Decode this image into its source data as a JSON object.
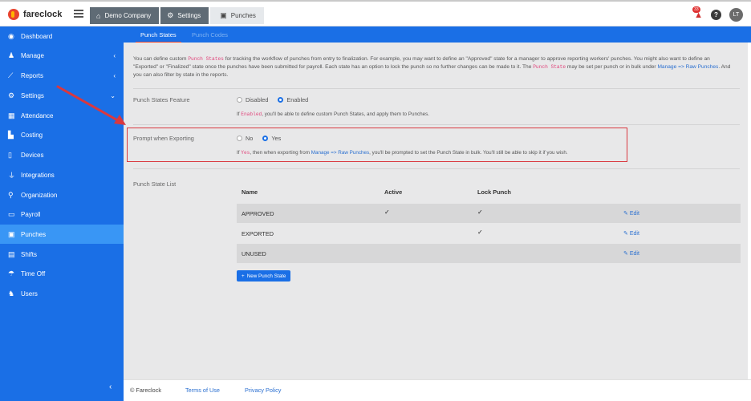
{
  "app": {
    "name": "fareclock"
  },
  "breadcrumb": [
    {
      "icon": "home-icon",
      "label": "Demo Company"
    },
    {
      "icon": "gear-icon",
      "label": "Settings"
    },
    {
      "icon": "punch-clock-icon",
      "label": "Punches"
    }
  ],
  "topbar": {
    "notification_count": "33",
    "help_label": "?",
    "avatar_initials": "LT"
  },
  "sidebar": {
    "items": [
      {
        "label": "Dashboard",
        "icon": "dashboard-icon",
        "chevron": ""
      },
      {
        "label": "Manage",
        "icon": "person-icon",
        "chevron": "‹"
      },
      {
        "label": "Reports",
        "icon": "chart-icon",
        "chevron": "‹"
      },
      {
        "label": "Settings",
        "icon": "gear-icon",
        "chevron": "⌄"
      },
      {
        "label": "Attendance",
        "icon": "grid-icon",
        "chevron": ""
      },
      {
        "label": "Costing",
        "icon": "bar-chart-icon",
        "chevron": ""
      },
      {
        "label": "Devices",
        "icon": "tablet-icon",
        "chevron": ""
      },
      {
        "label": "Integrations",
        "icon": "plug-icon",
        "chevron": ""
      },
      {
        "label": "Organization",
        "icon": "sitemap-icon",
        "chevron": ""
      },
      {
        "label": "Payroll",
        "icon": "money-icon",
        "chevron": ""
      },
      {
        "label": "Punches",
        "icon": "punch-clock-icon",
        "chevron": ""
      },
      {
        "label": "Shifts",
        "icon": "calendar-icon",
        "chevron": ""
      },
      {
        "label": "Time Off",
        "icon": "umbrella-icon",
        "chevron": ""
      },
      {
        "label": "Users",
        "icon": "users-icon",
        "chevron": ""
      }
    ],
    "active_index": 10,
    "collapse_label": "‹"
  },
  "tabs": [
    {
      "label": "Punch States",
      "active": true
    },
    {
      "label": "Punch Codes",
      "active": false
    }
  ],
  "intro": {
    "p1": "You can define custom ",
    "code1": "Punch States",
    "p2": " for tracking the workflow of punches from entry to finalization. For example, you may want to define an \"Approved\" state for a manager to approve reporting workers' punches. You might also want to define an \"Exported\" or \"Finalized\" state once the punches have been submitted for payroll. Each state has an option to lock the punch so no further changes can be made to it. The ",
    "code2": "Punch State",
    "p3": " may be set per punch or in bulk under ",
    "link": "Manage => Raw Punches",
    "p4": ". And you can also filter by state in the reports."
  },
  "feature": {
    "label": "Punch States Feature",
    "options": [
      "Disabled",
      "Enabled"
    ],
    "selected": "Enabled",
    "help_prefix": "If ",
    "help_code": "Enabled",
    "help_suffix": ", you'll be able to define custom Punch States, and apply them to Punches."
  },
  "prompt": {
    "label": "Prompt when Exporting",
    "options": [
      "No",
      "Yes"
    ],
    "selected": "Yes",
    "help_prefix": "If ",
    "help_code": "Yes",
    "help_mid": ", then when exporting from ",
    "help_link": "Manage => Raw Punches",
    "help_suffix": ", you'll be prompted to set the Punch State in bulk. You'll still be able to skip it if you wish."
  },
  "list": {
    "label": "Punch State List",
    "columns": [
      "Name",
      "Active",
      "Lock Punch"
    ],
    "rows": [
      {
        "name": "APPROVED",
        "active": true,
        "lock": true,
        "edit": "Edit"
      },
      {
        "name": "EXPORTED",
        "active": false,
        "lock": true,
        "edit": "Edit"
      },
      {
        "name": "UNUSED",
        "active": false,
        "lock": false,
        "edit": "Edit"
      }
    ],
    "new_button": "New Punch State"
  },
  "footer": {
    "copyright": "© Fareclock",
    "terms": "Terms of Use",
    "privacy": "Privacy Policy"
  },
  "colors": {
    "brand_blue": "#1a6fe6",
    "active_item": "#3996f5",
    "highlight_red": "#d9383f"
  }
}
